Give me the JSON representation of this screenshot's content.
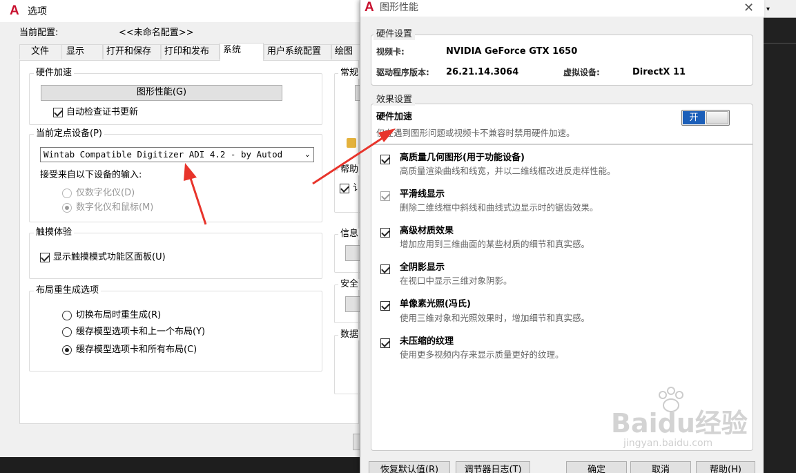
{
  "options_window": {
    "title": "选项",
    "current_profile_label": "当前配置:",
    "current_profile_value": "<<未命名配置>>",
    "tabs": [
      "文件",
      "显示",
      "打开和保存",
      "打印和发布",
      "系统",
      "用户系统配置",
      "绘图"
    ],
    "active_tab": "系统",
    "hardware_accel": {
      "legend": "硬件加速",
      "button_label": "图形性能(G)",
      "auto_check_label": "自动检查证书更新"
    },
    "pointing_device": {
      "legend": "当前定点设备(P)",
      "selected": "Wintab Compatible Digitizer ADI 4.2 - by Autod",
      "accept_input_label": "接受来自以下设备的输入:",
      "option_digitizer_only": "仅数字化仪(D)",
      "option_digitizer_mouse": "数字化仪和鼠标(M)"
    },
    "touch": {
      "legend": "触摸体验",
      "show_touch_panel_label": "显示触摸模式功能区面板(U)"
    },
    "layout_regen": {
      "legend": "布局重生成选项",
      "option_regen_on_switch": "切换布局时重生成(R)",
      "option_cache_model_last": "缓存模型选项卡和上一个布局(Y)",
      "option_cache_model_all": "缓存模型选项卡和所有布局(C)"
    },
    "right_column_partial": {
      "general": "常规",
      "help": "帮助",
      "help_check_partial": "讠",
      "info": "信息",
      "security": "安全",
      "database": "数据"
    }
  },
  "graphics_dialog": {
    "title": "图形性能",
    "hardware_settings": {
      "legend": "硬件设置",
      "video_card_label": "视频卡:",
      "video_card_value": "NVIDIA GeForce GTX 1650",
      "driver_label": "驱动程序版本:",
      "driver_value": "26.21.14.3064",
      "virtual_device_label": "虚拟设备:",
      "virtual_device_value": "DirectX 11"
    },
    "effects": {
      "legend": "效果设置",
      "hw_accel_title": "硬件加速",
      "hw_accel_desc": "仅在遇到图形问题或视频卡不兼容时禁用硬件加速。",
      "toggle_label": "开",
      "items": [
        {
          "title": "高质量几何图形(用于功能设备)",
          "desc": "高质量渲染曲线和线宽，并以二维线框改进反走样性能。",
          "checked": true,
          "disabled": false
        },
        {
          "title": "平滑线显示",
          "desc": "删除二维线框中斜线和曲线式边显示时的锯齿效果。",
          "checked": true,
          "disabled": true
        },
        {
          "title": "高级材质效果",
          "desc": "增加应用到三维曲面的某些材质的细节和真实感。",
          "checked": true,
          "disabled": false
        },
        {
          "title": "全阴影显示",
          "desc": "在视口中显示三维对象阴影。",
          "checked": true,
          "disabled": false
        },
        {
          "title": "单像素光照(冯氏)",
          "desc": "使用三维对象和光照效果时，增加细节和真实感。",
          "checked": true,
          "disabled": false
        },
        {
          "title": "未压缩的纹理",
          "desc": "使用更多视频内存来显示质量更好的纹理。",
          "checked": true,
          "disabled": false
        }
      ]
    },
    "buttons": {
      "restore_defaults": "恢复默认值(R)",
      "tuner_log": "调节器日志(T)",
      "ok": "确定",
      "cancel": "取消",
      "help": "帮助(H)"
    }
  },
  "watermark": {
    "brand": "Baidu经验",
    "url": "jingyan.baidu.com"
  },
  "colors": {
    "annotation_arrow": "#e8342b",
    "toggle_on": "#1c5fb9",
    "logo": "#c8102e"
  }
}
